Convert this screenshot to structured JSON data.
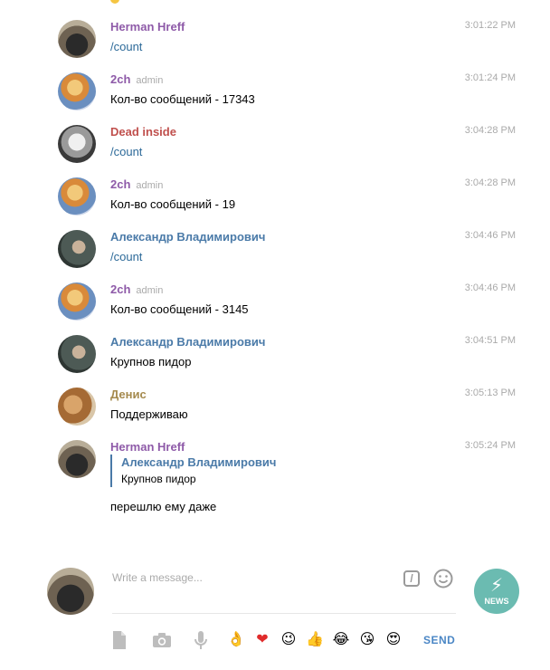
{
  "messages": [
    {
      "author": "Herman Hreff",
      "badge": "",
      "time": "3:01:22 PM",
      "text": "/count",
      "avatar": "herman-avatar"
    },
    {
      "author": "2ch",
      "badge": "admin",
      "time": "3:01:24 PM",
      "text": "Кол-во сообщений - 17343",
      "avatar": "2ch-avatar"
    },
    {
      "author": "Dead inside",
      "badge": "",
      "time": "3:04:28 PM",
      "text": "/count",
      "avatar": "dead-inside-avatar"
    },
    {
      "author": "2ch",
      "badge": "admin",
      "time": "3:04:28 PM",
      "text": "Кол-во сообщений - 19",
      "avatar": "2ch-avatar"
    },
    {
      "author": "Александр Владимирович",
      "badge": "",
      "time": "3:04:46 PM",
      "text": "/count",
      "avatar": "alexander-avatar"
    },
    {
      "author": "2ch",
      "badge": "admin",
      "time": "3:04:46 PM",
      "text": "Кол-во сообщений - 3145",
      "avatar": "2ch-avatar"
    },
    {
      "author": "Александр Владимирович",
      "badge": "",
      "time": "3:04:51 PM",
      "text": "Крупнов пидор",
      "avatar": "alexander-avatar"
    },
    {
      "author": "Денис",
      "badge": "",
      "time": "3:05:13 PM",
      "text": "Поддерживаю",
      "avatar": "denis-avatar"
    },
    {
      "author": "Herman Hreff",
      "badge": "",
      "time": "3:05:24 PM",
      "reply_author": "Александр Владимирович",
      "reply_text": "Крупнов пидор",
      "text": "перешлю ему даже",
      "avatar": "herman-avatar"
    }
  ],
  "composer": {
    "placeholder": "Write a message...",
    "send_label": "SEND"
  },
  "logo": {
    "text": "NEWS",
    "color": "#6bbbb1"
  },
  "toolbar": {
    "icons": [
      "file-icon",
      "camera-icon",
      "microphone-icon"
    ],
    "emojis": [
      "👌",
      "❤",
      "😉",
      "👍",
      "😂",
      "😘",
      "😍"
    ]
  },
  "colors": {
    "herman": "#8e5aa8",
    "dead_inside": "#c0504d",
    "alexander": "#4a7aa8",
    "denis": "#a58a4e",
    "send": "#4a86c5"
  }
}
